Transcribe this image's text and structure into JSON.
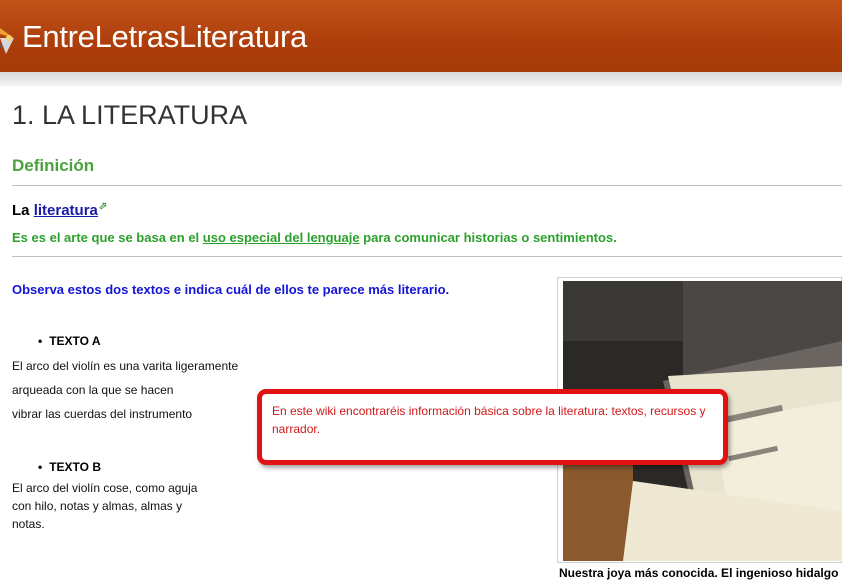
{
  "header": {
    "site_title": "EntreLetrasLiteratura",
    "logo_icon": "pinwheel-logo"
  },
  "page": {
    "title": "1. LA LITERATURA",
    "section_heading": "Definición",
    "definition": {
      "prefix": "La",
      "link_text": "literatura",
      "text_before": "Es es el arte que se basa en el ",
      "text_underlined": "uso especial del lenguaje",
      "text_after": " para comunicar historias o sentimientos."
    },
    "question": "Observa estos dos textos e indica cuál de ellos te parece más literario.",
    "texto_a": {
      "label": "TEXTO A",
      "lines": [
        "El arco del violín es una varita ligeramente",
        "arqueada con la que se hacen",
        "vibrar las cuerdas del instrumento"
      ]
    },
    "texto_b": {
      "label": "TEXTO B",
      "lines": [
        "El arco del violín cose, como aguja",
        "con hilo, notas y almas, almas y",
        "notas."
      ]
    },
    "image_caption": "Nuestra joya más conocida. El ingenioso hidalgo"
  },
  "callout": {
    "text": "En este wiki encontraréis información básica sobre la literatura: textos, recursos y narrador."
  },
  "colors": {
    "header": "#ad3e0b",
    "heading_green": "#4aa23c",
    "question_blue": "#1414d9",
    "callout_red": "#e21212"
  }
}
